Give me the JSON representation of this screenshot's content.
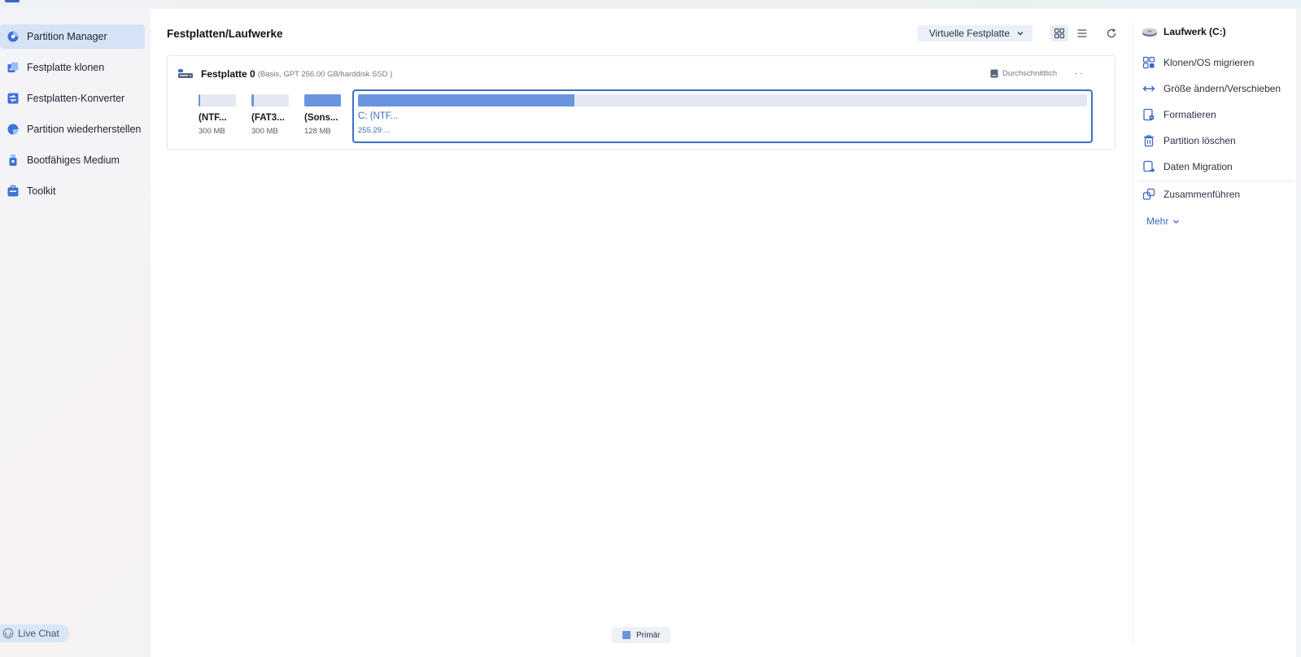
{
  "sidebar": {
    "items": [
      {
        "label": "Partition Manager",
        "icon": "pie-chart-icon",
        "active": true
      },
      {
        "label": "Festplatte klonen",
        "icon": "clone-icon"
      },
      {
        "label": "Festplatten-Konverter",
        "icon": "converter-icon"
      },
      {
        "label": "Partition wiederherstellen",
        "icon": "recover-icon"
      },
      {
        "label": "Bootfähiges Medium",
        "icon": "usb-icon"
      },
      {
        "label": "Toolkit",
        "icon": "toolkit-icon"
      }
    ],
    "live_chat": "Live Chat"
  },
  "main": {
    "title": "Festplatten/Laufwerke",
    "toolbar": {
      "virtual_disk_label": "Virtuelle Festplatte",
      "grid_view": "grid-view-icon",
      "list_view": "list-view-icon",
      "refresh": "refresh-icon"
    },
    "disk": {
      "name": "Festplatte 0",
      "info": "(Basis, GPT 256.00 GB/harddisk SSD )",
      "health": "Durchschnittlich",
      "extra": "- -",
      "partitions": [
        {
          "label": "(NTF...",
          "size": "300 MB",
          "used_fraction": 0.05
        },
        {
          "label": "(FAT3...",
          "size": "300 MB",
          "used_fraction": 0.07
        },
        {
          "label": "(Sons...",
          "size": "128 MB",
          "used_fraction": 1.0
        },
        {
          "label": "C: (NTF...",
          "size": "255.29 ...",
          "used_fraction": 0.297,
          "selected": true
        }
      ]
    },
    "legend": {
      "primary": "Primär",
      "primary_color": "#6a95de"
    }
  },
  "right_panel": {
    "drive_title": "Laufwerk (C:)",
    "actions": [
      {
        "label": "Klonen/OS migrieren",
        "icon": "clone-os-icon"
      },
      {
        "label": "Größe ändern/Verschieben",
        "icon": "resize-icon"
      },
      {
        "label": "Formatieren",
        "icon": "format-icon"
      },
      {
        "label": "Partition löschen",
        "icon": "trash-icon"
      },
      {
        "label": "Daten Migration",
        "icon": "data-migration-icon"
      },
      {
        "label": "Zusammenführen",
        "icon": "merge-icon"
      }
    ],
    "more_label": "Mehr"
  },
  "colors": {
    "accent": "#3f6fc4",
    "partition_fill": "#6a95de",
    "active_nav": "#d6e3f7"
  }
}
